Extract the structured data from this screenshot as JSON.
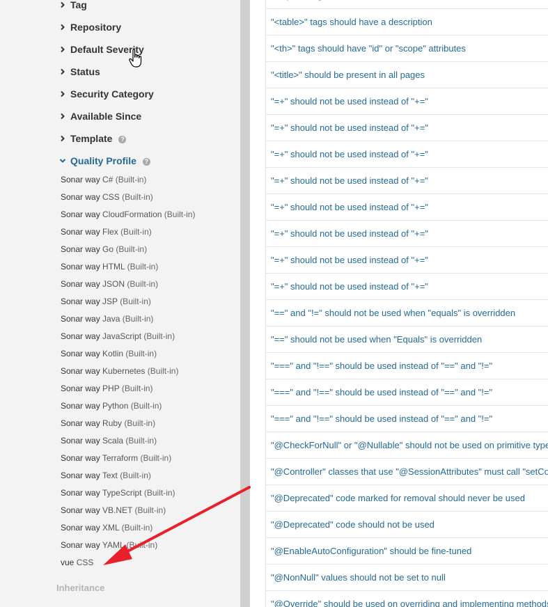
{
  "sidebar": {
    "facets": [
      {
        "label": "Tag",
        "expanded": false,
        "help": false
      },
      {
        "label": "Repository",
        "expanded": false,
        "help": false
      },
      {
        "label": "Default Severity",
        "expanded": false,
        "help": false
      },
      {
        "label": "Status",
        "expanded": false,
        "help": false
      },
      {
        "label": "Security Category",
        "expanded": false,
        "help": false
      },
      {
        "label": "Available Since",
        "expanded": false,
        "help": false
      },
      {
        "label": "Template",
        "expanded": false,
        "help": true
      },
      {
        "label": "Quality Profile",
        "expanded": true,
        "help": true
      }
    ],
    "help_glyph": "?",
    "quality_profiles": [
      {
        "name": "Sonar way",
        "lang": "C#",
        "suffix": "(Built-in)"
      },
      {
        "name": "Sonar way",
        "lang": "CSS",
        "suffix": "(Built-in)"
      },
      {
        "name": "Sonar way",
        "lang": "CloudFormation",
        "suffix": "(Built-in)"
      },
      {
        "name": "Sonar way",
        "lang": "Flex",
        "suffix": "(Built-in)"
      },
      {
        "name": "Sonar way",
        "lang": "Go",
        "suffix": "(Built-in)"
      },
      {
        "name": "Sonar way",
        "lang": "HTML",
        "suffix": "(Built-in)"
      },
      {
        "name": "Sonar way",
        "lang": "JSON",
        "suffix": "(Built-in)"
      },
      {
        "name": "Sonar way",
        "lang": "JSP",
        "suffix": "(Built-in)"
      },
      {
        "name": "Sonar way",
        "lang": "Java",
        "suffix": "(Built-in)"
      },
      {
        "name": "Sonar way",
        "lang": "JavaScript",
        "suffix": "(Built-in)"
      },
      {
        "name": "Sonar way",
        "lang": "Kotlin",
        "suffix": "(Built-in)"
      },
      {
        "name": "Sonar way",
        "lang": "Kubernetes",
        "suffix": "(Built-in)"
      },
      {
        "name": "Sonar way",
        "lang": "PHP",
        "suffix": "(Built-in)"
      },
      {
        "name": "Sonar way",
        "lang": "Python",
        "suffix": "(Built-in)"
      },
      {
        "name": "Sonar way",
        "lang": "Ruby",
        "suffix": "(Built-in)"
      },
      {
        "name": "Sonar way",
        "lang": "Scala",
        "suffix": "(Built-in)"
      },
      {
        "name": "Sonar way",
        "lang": "Terraform",
        "suffix": "(Built-in)"
      },
      {
        "name": "Sonar way",
        "lang": "Text",
        "suffix": "(Built-in)"
      },
      {
        "name": "Sonar way",
        "lang": "TypeScript",
        "suffix": "(Built-in)"
      },
      {
        "name": "Sonar way",
        "lang": "VB.NET",
        "suffix": "(Built-in)"
      },
      {
        "name": "Sonar way",
        "lang": "XML",
        "suffix": "(Built-in)"
      },
      {
        "name": "Sonar way",
        "lang": "YAML",
        "suffix": "(Built-in)"
      },
      {
        "name": "vue",
        "lang": "CSS",
        "suffix": ""
      }
    ],
    "inheritance_label": "Inheritance"
  },
  "rules": [
    "\"<input>\" tags should have a label",
    "\"<table>\" tags should have a description",
    "\"<th>\" tags should have \"id\" or \"scope\" attributes",
    "\"<title>\" should be present in all pages",
    "\"=+\" should not be used instead of \"+=\"",
    "\"=+\" should not be used instead of \"+=\"",
    "\"=+\" should not be used instead of \"+=\"",
    "\"=+\" should not be used instead of \"+=\"",
    "\"=+\" should not be used instead of \"+=\"",
    "\"=+\" should not be used instead of \"+=\"",
    "\"=+\" should not be used instead of \"+=\"",
    "\"=+\" should not be used instead of \"+=\"",
    "\"==\" and \"!=\" should not be used when \"equals\" is overridden",
    "\"==\" should not be used when \"Equals\" is overridden",
    "\"===\" and \"!==\" should be used instead of \"==\" and \"!=\"",
    "\"===\" and \"!==\" should be used instead of \"==\" and \"!=\"",
    "\"===\" and \"!==\" should be used instead of \"==\" and \"!=\"",
    "\"@CheckForNull\" or \"@Nullable\" should not be used on primitive types",
    "\"@Controller\" classes that use \"@SessionAttributes\" must call \"setComplete\"",
    "\"@Deprecated\" code marked for removal should never be used",
    "\"@Deprecated\" code should not be used",
    "\"@EnableAutoConfiguration\" should be fine-tuned",
    "\"@NonNull\" values should not be set to null",
    "\"@Override\" should be used on overriding and implementing methods"
  ],
  "colors": {
    "link": "#236a97",
    "sidebar_bg": "#f3f3f3",
    "annotation_arrow": "#e8202a"
  }
}
